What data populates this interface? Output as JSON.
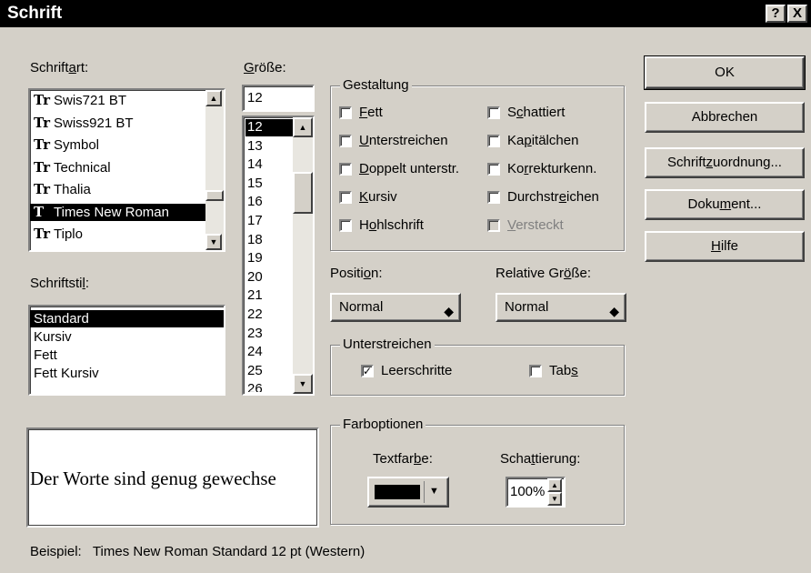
{
  "window": {
    "title": "Schrift",
    "help_button": "?",
    "close_button": "X"
  },
  "schriftart": {
    "label_pre": "Schrift",
    "label_u": "a",
    "label_post": "rt:",
    "items": [
      {
        "icon": "Tr",
        "label": "Swis721 BT"
      },
      {
        "icon": "Tr",
        "label": "Swiss921 BT"
      },
      {
        "icon": "Tr",
        "label": "Symbol"
      },
      {
        "icon": "Tr",
        "label": "Technical"
      },
      {
        "icon": "Tr",
        "label": "Thalia"
      },
      {
        "icon": "T",
        "label": "Times New Roman",
        "selected": true
      },
      {
        "icon": "Tr",
        "label": "Tiplo"
      }
    ]
  },
  "schriftstil": {
    "label_pre": "Schriftsti",
    "label_u": "l",
    "label_post": ":",
    "items": [
      "Standard",
      "Kursiv",
      "Fett",
      "Fett Kursiv"
    ],
    "selected": "Standard"
  },
  "groesse": {
    "label_u": "G",
    "label_post": "röße:",
    "value": "12",
    "items": [
      "12",
      "13",
      "14",
      "15",
      "16",
      "17",
      "18",
      "19",
      "20",
      "21",
      "22",
      "23",
      "24",
      "25",
      "26"
    ]
  },
  "gestaltung": {
    "title": "Gestaltung",
    "left": [
      {
        "pre": "",
        "u": "F",
        "post": "ett",
        "checked": false
      },
      {
        "pre": "",
        "u": "U",
        "post": "nterstreichen",
        "checked": false
      },
      {
        "pre": "",
        "u": "D",
        "post": "oppelt unterstr.",
        "checked": false
      },
      {
        "pre": "",
        "u": "K",
        "post": "ursiv",
        "checked": false
      },
      {
        "pre": "H",
        "u": "o",
        "post": "hlschrift",
        "checked": false
      }
    ],
    "right": [
      {
        "pre": "S",
        "u": "c",
        "post": "hattiert",
        "checked": false,
        "disabled": false
      },
      {
        "pre": "Ka",
        "u": "p",
        "post": "itälchen",
        "checked": false,
        "disabled": false
      },
      {
        "pre": "Ko",
        "u": "r",
        "post": "rekturkenn.",
        "checked": false,
        "disabled": false
      },
      {
        "pre": "Durchstr",
        "u": "e",
        "post": "ichen",
        "checked": false,
        "disabled": false
      },
      {
        "pre": "",
        "u": "V",
        "post": "ersteckt",
        "checked": false,
        "disabled": true
      }
    ]
  },
  "position": {
    "label_pre": "Positi",
    "label_u": "o",
    "label_post": "n:",
    "value": "Normal"
  },
  "relative_groesse": {
    "label_pre": "Relative Gr",
    "label_u": "ö",
    "label_post": "ße:",
    "value": "Normal"
  },
  "unterstreichen": {
    "title": "Unterstreichen",
    "leerschritte": {
      "label": "Leerschritte",
      "checked": true,
      "check_glyph": "✓"
    },
    "tabs": {
      "pre": "Tab",
      "u": "s",
      "post": "",
      "checked": false
    }
  },
  "farboptionen": {
    "title": "Farboptionen",
    "textfarbe": {
      "pre": "Textfar",
      "u": "b",
      "post": "e:",
      "color": "#000000"
    },
    "schattierung": {
      "pre": "Scha",
      "u": "t",
      "post": "tierung:",
      "value": "100%"
    }
  },
  "preview": {
    "text": "Der Worte sind genug gewechse"
  },
  "beispiel": {
    "text": "Beispiel:   Times New Roman Standard 12 pt (Western)"
  },
  "buttons": {
    "ok": "OK",
    "abbrechen": "Abbrechen",
    "schriftzuordnung": {
      "pre": "Schrift",
      "u": "z",
      "post": "uordnung..."
    },
    "dokument": {
      "pre": "Doku",
      "u": "m",
      "post": "ent..."
    },
    "hilfe": {
      "pre": "",
      "u": "H",
      "post": "ilfe"
    }
  }
}
